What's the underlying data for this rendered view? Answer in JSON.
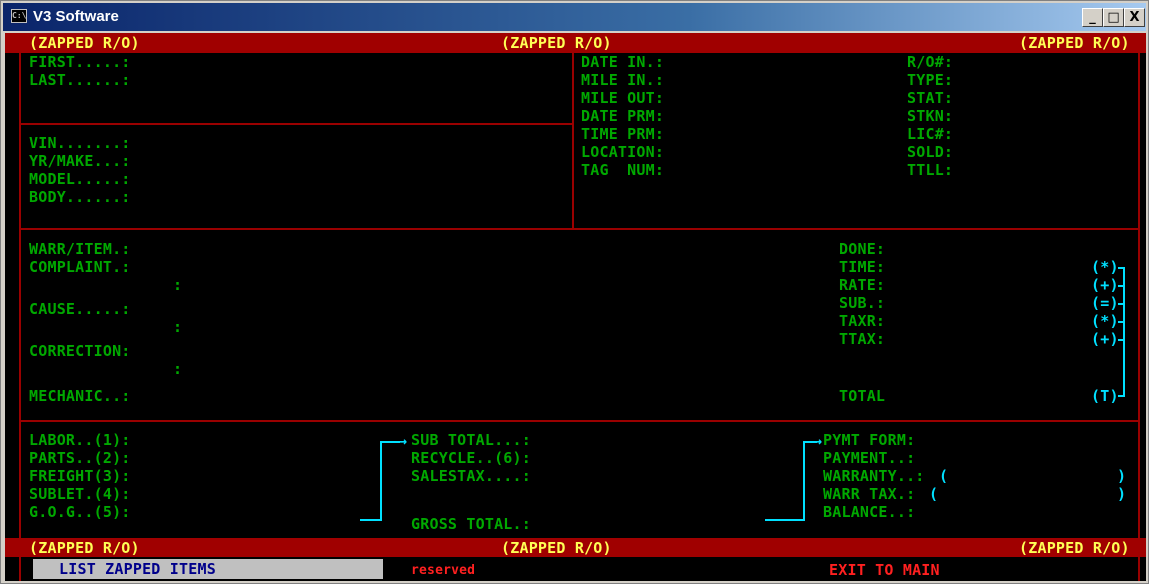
{
  "window": {
    "title": "V3 Software",
    "icon": "console-icon",
    "minimize": "_",
    "maximize": "□",
    "close": "X"
  },
  "banner": {
    "left": "(ZAPPED R/O)",
    "center": "(ZAPPED R/O)",
    "right": "(ZAPPED R/O)"
  },
  "customer": {
    "first": "FIRST.....:",
    "last": "LAST......:"
  },
  "vehicle": {
    "vin": "VIN.......:",
    "yr_make": "YR/MAKE...:",
    "model": "MODEL.....:",
    "body": "BODY......:"
  },
  "dates": {
    "date_in": "DATE IN.:",
    "mile_in": "MILE IN.:",
    "mile_out": "MILE OUT:",
    "date_prm": "DATE PRM:",
    "time_prm": "TIME PRM:",
    "location": "LOCATION:",
    "tag_num": "TAG  NUM:"
  },
  "ro": {
    "ro_num": "R/O#:",
    "type": "TYPE:",
    "stat": "STAT:",
    "stkn": "STKN:",
    "lic": "LIC#:",
    "sold": "SOLD:",
    "ttll": "TTLL:"
  },
  "item": {
    "warr_item": "WARR/ITEM.:",
    "complaint": "COMPLAINT.:",
    "colon": ":",
    "cause": "CAUSE.....:",
    "correction": "CORRECTION:",
    "mechanic": "MECHANIC..:"
  },
  "calc": {
    "done": "DONE:",
    "time": "TIME:",
    "rate": "RATE:",
    "sub": "SUB.:",
    "taxr": "TAXR:",
    "ttax": "TTAX:",
    "total": "TOTAL",
    "op_mul": "(*)",
    "op_add": "(+)",
    "op_eq": "(=)",
    "op_mul2": "(*)",
    "op_add2": "(+)",
    "op_total": "(T)"
  },
  "costs": {
    "labor": "LABOR..(1):",
    "parts": "PARTS..(2):",
    "freight": "FREIGHT(3):",
    "sublet": "SUBLET.(4):",
    "gog": "G.O.G..(5):"
  },
  "totals": {
    "sub_total": "SUB TOTAL...:",
    "recycle": "RECYCLE..(6):",
    "salestax": "SALESTAX....:",
    "gross_total": "GROSS TOTAL.:"
  },
  "payment": {
    "pymt_form": "PYMT FORM:",
    "payment": "PAYMENT..:",
    "warranty": "WARRANTY..:",
    "warr_tax": "WARR TAX.:",
    "balance": "BALANCE..:",
    "open_paren": "(",
    "close_paren": ")"
  },
  "menu": {
    "list_zapped": "LIST ZAPPED ITEMS",
    "reserved": "reserved",
    "exit": "EXIT TO MAIN"
  },
  "colors": {
    "label_green": "#00a800",
    "accent_cyan": "#00e0ff",
    "banner_red": "#a00000",
    "banner_text": "#ffff55",
    "frame_red": "#9a0000",
    "menu_red": "#ff2020"
  }
}
